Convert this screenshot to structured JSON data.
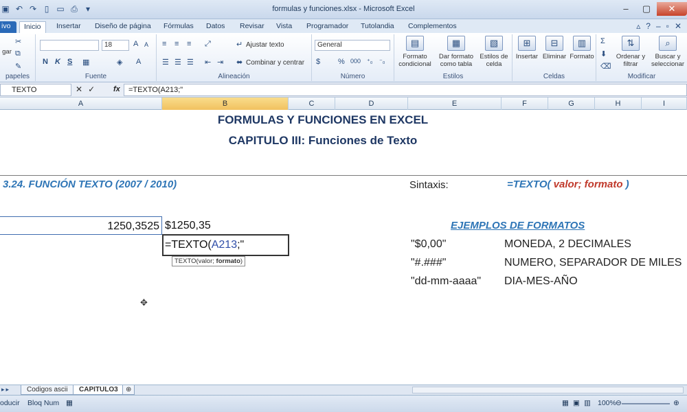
{
  "window": {
    "title": "formulas y funciones.xlsx  -  Microsoft Excel",
    "qat_icons": [
      "save-icon",
      "undo-icon",
      "redo-icon",
      "new-icon",
      "open-icon",
      "print-preview-icon",
      "customize-icon"
    ]
  },
  "tabs": [
    {
      "label": "ivo"
    },
    {
      "label": "Inicio"
    },
    {
      "label": "Insertar"
    },
    {
      "label": "Diseño de página"
    },
    {
      "label": "Fórmulas"
    },
    {
      "label": "Datos"
    },
    {
      "label": "Revisar"
    },
    {
      "label": "Vista"
    },
    {
      "label": "Programador"
    },
    {
      "label": "Tutolandia"
    },
    {
      "label": "Complementos"
    }
  ],
  "ribbon": {
    "clipboard": {
      "paste": "gar",
      "label": "papeles"
    },
    "font": {
      "name": "",
      "size": "18",
      "label": "Fuente",
      "bold": "N",
      "italic": "K",
      "underline": "S"
    },
    "alignment": {
      "wrap": "Ajustar texto",
      "merge": "Combinar y centrar",
      "label": "Alineación"
    },
    "number": {
      "format": "General",
      "currency": "$",
      "percent": "%",
      "thousands": "000",
      "label": "Número"
    },
    "styles": {
      "conditional": "Formato condicional",
      "as_table": "Dar formato como tabla",
      "cell_styles": "Estilos de celda",
      "label": "Estilos"
    },
    "cells": {
      "insert": "Insertar",
      "delete": "Eliminar",
      "format": "Formato",
      "label": "Celdas"
    },
    "editing": {
      "sort": "Ordenar y filtrar",
      "find": "Buscar y seleccionar",
      "label": "Modificar"
    }
  },
  "formula_bar": {
    "name_box": "TEXTO",
    "fx": "fx",
    "content": "=TEXTO(A213;\""
  },
  "columns": [
    "A",
    "B",
    "C",
    "D",
    "E",
    "F",
    "G",
    "H",
    "I"
  ],
  "sheet": {
    "title1": "FORMULAS Y FUNCIONES EN EXCEL",
    "title2": "CAPITULO III: Funciones de Texto",
    "section": "3.24. FUNCIÓN TEXTO (2007 / 2010)",
    "syntax_label": "Sintaxis:",
    "syntax_fn": "=TEXTO(",
    "syntax_args": " valor; formato",
    "syntax_close": " )",
    "cell_a_value": "1250,3525",
    "cell_b_value": "$1250,35",
    "edit_prefix": "=TEXTO(",
    "edit_ref": "A213",
    "edit_suffix": ";\"",
    "tooltip_fn": "TEXTO(valor; ",
    "tooltip_arg": "formato",
    "tooltip_close": ")",
    "examples_title": "EJEMPLOS DE FORMATOS",
    "examples": [
      {
        "format": "\"$0,00\"",
        "desc": "MONEDA, 2 DECIMALES"
      },
      {
        "format": "\"#.###\"",
        "desc": "NUMERO, SEPARADOR DE MILES"
      },
      {
        "format": "\"dd-mm-aaaa\"",
        "desc": "DIA-MES-AÑO"
      }
    ]
  },
  "sheet_tabs": [
    {
      "label": "Codigos ascii"
    },
    {
      "label": "CAPITULO3"
    }
  ],
  "status": {
    "mode": "oducir",
    "num": "Bloq Num",
    "zoom": "100%"
  }
}
